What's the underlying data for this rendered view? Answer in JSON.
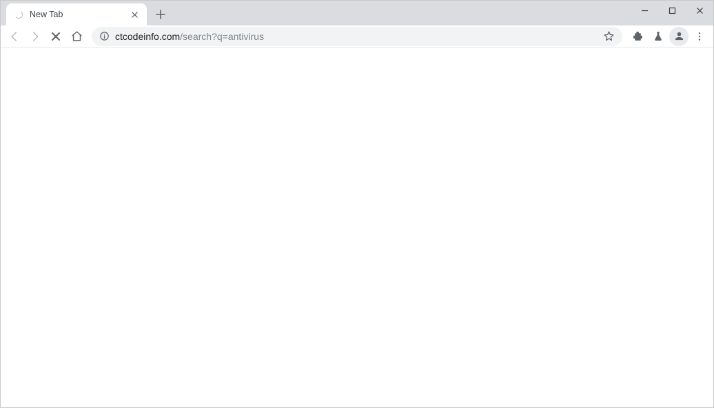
{
  "window": {
    "minimize": "—",
    "maximize": "▢",
    "close": "✕"
  },
  "tabs": [
    {
      "title": "New Tab",
      "loading": true
    }
  ],
  "address": {
    "host": "ctcodeinfo.com",
    "path": "/search?q=antivirus"
  }
}
